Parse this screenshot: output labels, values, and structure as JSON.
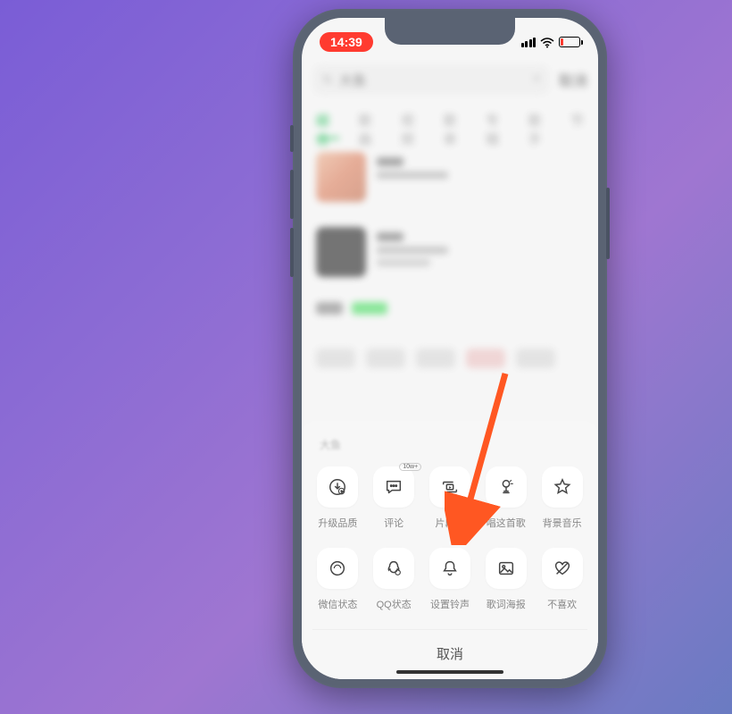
{
  "status": {
    "time": "14:39"
  },
  "search": {
    "query": "大鱼",
    "cancel": "取消"
  },
  "tabs": {
    "t1": "综合",
    "t2": "歌曲",
    "t3": "视频",
    "t4": "歌单",
    "t5": "专辑",
    "t6": "歌手",
    "t7": "节"
  },
  "sheet": {
    "headerHint": "大鱼",
    "row1": {
      "i1": "升级品质",
      "i2": "评论",
      "i2badge": "10w+",
      "i3": "片段分",
      "i4": "唱这首歌",
      "i5": "背景音乐"
    },
    "row2": {
      "i1": "微信状态",
      "i2": "QQ状态",
      "i3": "设置铃声",
      "i4": "歌词海报",
      "i5": "不喜欢"
    },
    "cancel": "取消"
  }
}
